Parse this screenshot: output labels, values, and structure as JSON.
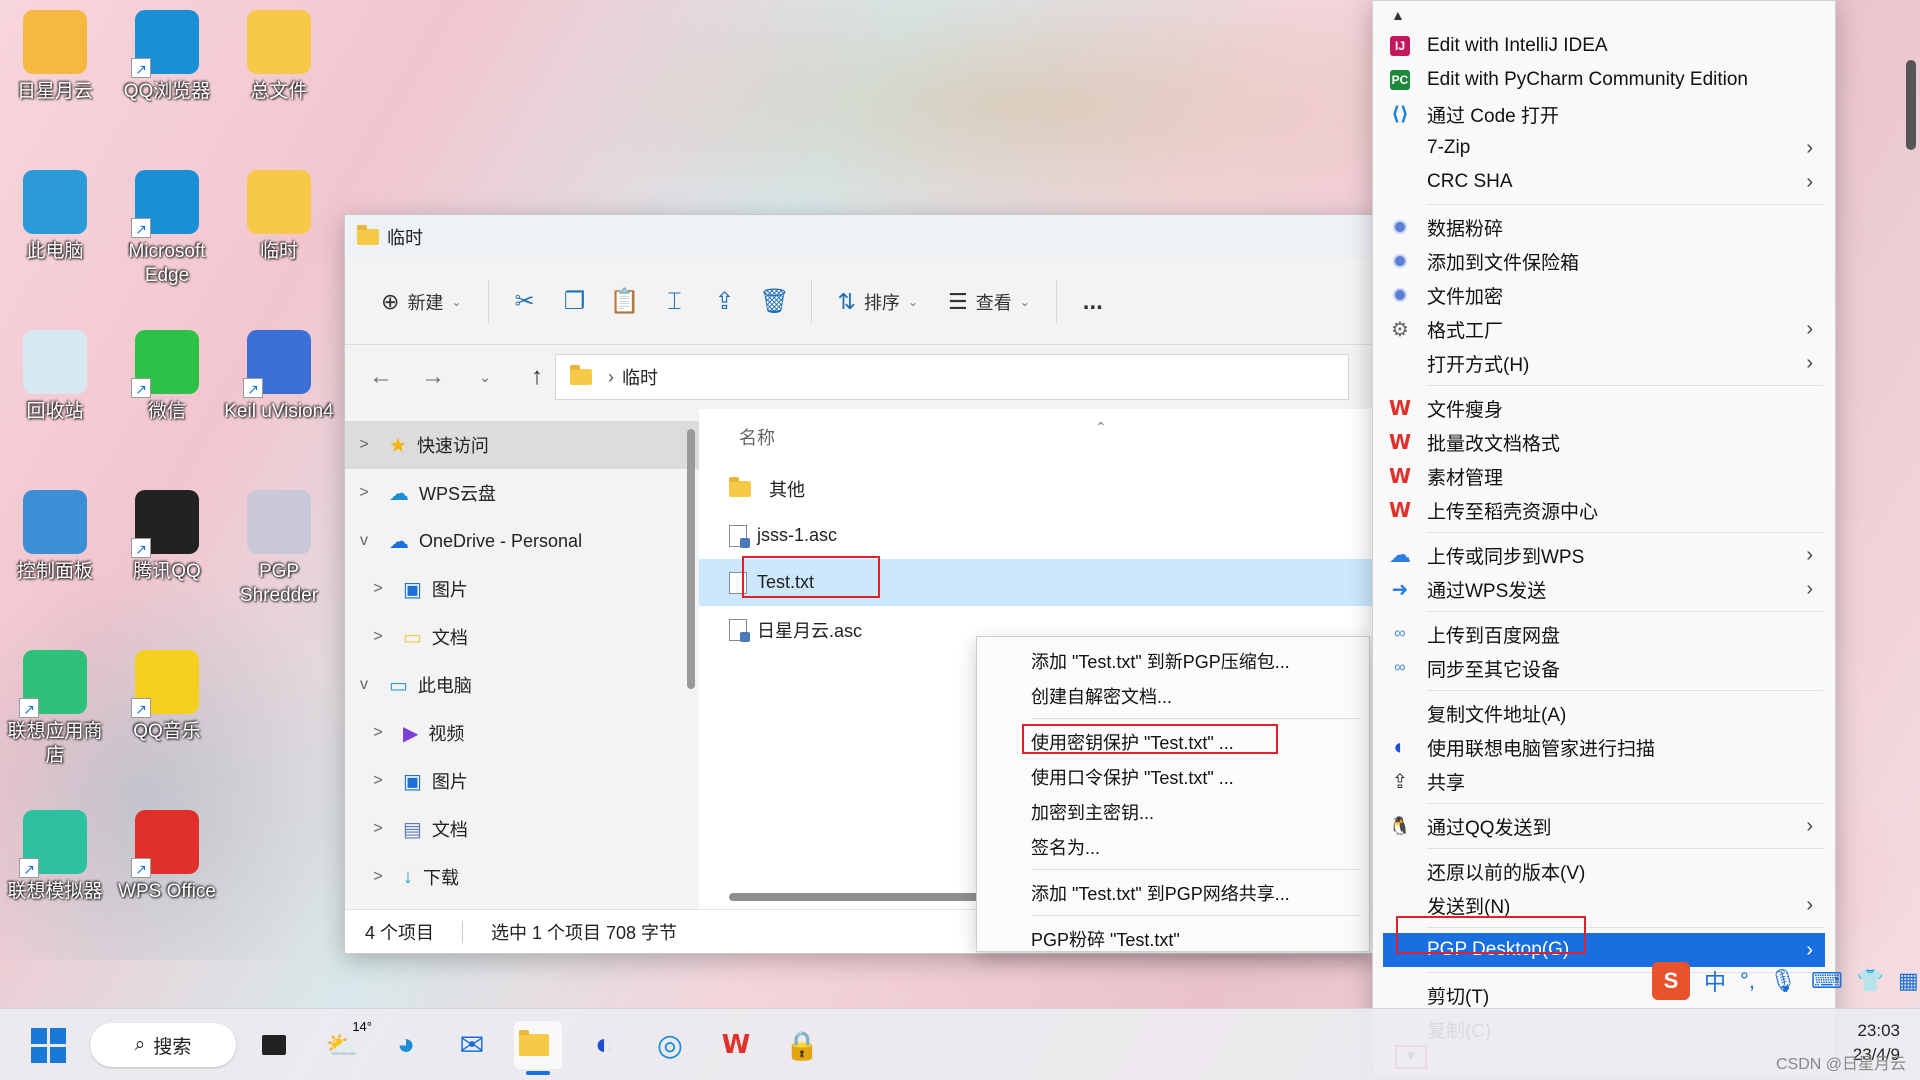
{
  "desktop_icons": [
    {
      "label": "日星月云"
    },
    {
      "label": "QQ浏览器"
    },
    {
      "label": "总文件"
    },
    {
      "label": "此电脑"
    },
    {
      "label": "Microsoft Edge"
    },
    {
      "label": "临时"
    },
    {
      "label": "回收站"
    },
    {
      "label": "微信"
    },
    {
      "label": "Keil uVision4"
    },
    {
      "label": "控制面板"
    },
    {
      "label": "腾讯QQ"
    },
    {
      "label": "PGP Shredder"
    },
    {
      "label": "联想应用商店"
    },
    {
      "label": "QQ音乐"
    },
    {
      "label": "联想模拟器"
    },
    {
      "label": "WPS Office"
    }
  ],
  "explorer": {
    "title": "临时",
    "toolbar": {
      "new": "新建",
      "sort": "排序",
      "view": "查看",
      "more": "..."
    },
    "address": "临时",
    "nav_pane": [
      {
        "label": "快速访问",
        "chev": ">"
      },
      {
        "label": "WPS云盘",
        "chev": ">"
      },
      {
        "label": "OneDrive - Personal",
        "chev": "v"
      },
      {
        "label": "图片",
        "chev": ">"
      },
      {
        "label": "文档",
        "chev": ">"
      },
      {
        "label": "此电脑",
        "chev": "v"
      },
      {
        "label": "视频",
        "chev": ">"
      },
      {
        "label": "图片",
        "chev": ">"
      },
      {
        "label": "文档",
        "chev": ">"
      },
      {
        "label": "下载",
        "chev": ">"
      }
    ],
    "column_header": "名称",
    "files": [
      {
        "name": "其他",
        "type": "folder"
      },
      {
        "name": "jsss-1.asc",
        "type": "asc"
      },
      {
        "name": "Test.txt",
        "type": "txt"
      },
      {
        "name": "日星月云.asc",
        "type": "asc"
      }
    ],
    "status": {
      "count": "4 个项目",
      "selection": "选中 1 个项目  708 字节"
    }
  },
  "pgp_submenu": {
    "items": [
      "添加 \"Test.txt\" 到新PGP压缩包...",
      "创建自解密文档...",
      "使用密钥保护 \"Test.txt\" ...",
      "使用口令保护 \"Test.txt\" ...",
      "加密到主密钥...",
      "签名为...",
      "添加 \"Test.txt\" 到PGP网络共享...",
      "PGP粉碎 \"Test.txt\""
    ]
  },
  "context_menu": {
    "items": [
      {
        "label": "Edit with IntelliJ IDEA",
        "icon": "intellij-icon"
      },
      {
        "label": "Edit with PyCharm Community Edition",
        "icon": "pycharm-icon"
      },
      {
        "label": "通过 Code 打开",
        "icon": "vscode-icon"
      },
      {
        "label": "7-Zip",
        "icon": "",
        "sub": true
      },
      {
        "label": "CRC SHA",
        "icon": "",
        "sub": true
      },
      {
        "label": "数据粉碎",
        "icon": "pgp-dot-icon"
      },
      {
        "label": "添加到文件保险箱",
        "icon": "pgp-dot-icon"
      },
      {
        "label": "文件加密",
        "icon": "pgp-dot-icon"
      },
      {
        "label": "格式工厂",
        "icon": "format-factory-icon",
        "sub": true
      },
      {
        "label": "打开方式(H)",
        "icon": "",
        "sub": true
      },
      {
        "label": "文件瘦身",
        "icon": "wps-icon"
      },
      {
        "label": "批量改文档格式",
        "icon": "wps-icon"
      },
      {
        "label": "素材管理",
        "icon": "wps-icon"
      },
      {
        "label": "上传至稻壳资源中心",
        "icon": "wps-icon"
      },
      {
        "label": "上传或同步到WPS",
        "icon": "cloud-upload-icon",
        "sub": true
      },
      {
        "label": "通过WPS发送",
        "icon": "send-icon",
        "sub": true
      },
      {
        "label": "上传到百度网盘",
        "icon": "baidu-icon"
      },
      {
        "label": "同步至其它设备",
        "icon": "baidu-icon"
      },
      {
        "label": "复制文件地址(A)",
        "icon": ""
      },
      {
        "label": "使用联想电脑管家进行扫描",
        "icon": "lenovo-shield-icon"
      },
      {
        "label": "共享",
        "icon": "share-icon"
      },
      {
        "label": "通过QQ发送到",
        "icon": "qq-icon",
        "sub": true
      },
      {
        "label": "还原以前的版本(V)",
        "icon": ""
      },
      {
        "label": "发送到(N)",
        "icon": "",
        "sub": true
      },
      {
        "label": "PGP Desktop(G)",
        "icon": "",
        "sub": true
      },
      {
        "label": "剪切(T)",
        "icon": ""
      },
      {
        "label": "复制(C)",
        "icon": ""
      }
    ]
  },
  "taskbar": {
    "search": "搜索",
    "weather": "14°",
    "time": "23:03",
    "date": "23/4/9"
  },
  "ime": {
    "lang": "中",
    "punct": "°,"
  },
  "watermark": "CSDN @日星月云",
  "colors": {
    "accent": "#1a6fe0",
    "highlight": "#e0202a",
    "selected_row": "#cce8ff"
  }
}
